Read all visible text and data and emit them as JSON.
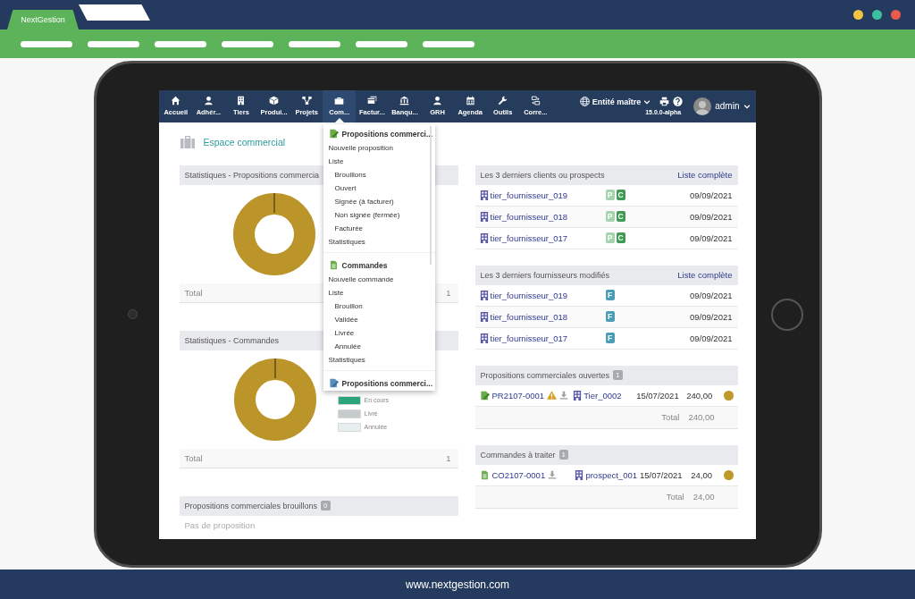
{
  "browser": {
    "tabs": [
      {
        "label": "NextGestion",
        "selected": true
      }
    ],
    "footer": "www.nextgestion.com"
  },
  "app": {
    "menu": [
      {
        "label": "Accueil",
        "selected": false
      },
      {
        "label": "Adhér...",
        "selected": false
      },
      {
        "label": "Tiers",
        "selected": false
      },
      {
        "label": "Produi...",
        "selected": false
      },
      {
        "label": "Projets",
        "selected": false
      },
      {
        "label": "Com...",
        "selected": true
      },
      {
        "label": "Factur...",
        "selected": false
      },
      {
        "label": "Banqu...",
        "selected": false
      },
      {
        "label": "GRH",
        "selected": false
      },
      {
        "label": "Agenda",
        "selected": false
      },
      {
        "label": "Outils",
        "selected": false
      },
      {
        "label": "Corre...",
        "selected": false
      }
    ],
    "entity": "Entité maître",
    "version": "15.0.0-alpha",
    "user": "admin"
  },
  "dropdown": {
    "sections": [
      {
        "title": "Propositions commerci...",
        "items": [
          {
            "label": "Nouvelle proposition"
          },
          {
            "label": "Liste",
            "children": [
              {
                "label": "Brouillons"
              },
              {
                "label": "Ouvert"
              },
              {
                "label": "Signée (à facturer)"
              },
              {
                "label": "Non signée (fermée)"
              },
              {
                "label": "Facturée"
              }
            ]
          },
          {
            "label": "Statistiques"
          }
        ]
      },
      {
        "title": "Commandes",
        "items": [
          {
            "label": "Nouvelle commande"
          },
          {
            "label": "Liste",
            "children": [
              {
                "label": "Brouillon"
              },
              {
                "label": "Validée"
              },
              {
                "label": "Livrée"
              },
              {
                "label": "Annulée"
              }
            ]
          },
          {
            "label": "Statistiques"
          }
        ]
      },
      {
        "title": "Propositions commerci..."
      }
    ]
  },
  "page_title": "Espace commercial",
  "left_panels": [
    {
      "kind": "chart",
      "title": "Statistiques - Propositions commercia",
      "total_label": "Total",
      "total": "1"
    },
    {
      "kind": "chart",
      "title": "Statistiques - Commandes",
      "legend": [
        {
          "label": "En cours",
          "color": "#2aa57c"
        },
        {
          "label": "Livré",
          "color": "#c6cccb"
        },
        {
          "label": "Annulée",
          "color": "#e6eeee"
        }
      ],
      "total_label": "Total",
      "total": "1"
    },
    {
      "kind": "empty",
      "title": "Propositions commerciales brouillons",
      "badge": "0",
      "message": "Pas de proposition"
    }
  ],
  "right_panels": [
    {
      "kind": "thirdparties",
      "title": "Les 3 derniers clients ou prospects",
      "link": "Liste complète",
      "rows": [
        {
          "name": "tier_fournisseur_019",
          "tags": [
            {
              "text": "P",
              "kind": "prospect"
            },
            {
              "text": "C",
              "kind": "customer"
            }
          ],
          "date": "09/09/2021"
        },
        {
          "name": "tier_fournisseur_018",
          "tags": [
            {
              "text": "P",
              "kind": "prospect"
            },
            {
              "text": "C",
              "kind": "customer"
            }
          ],
          "date": "09/09/2021"
        },
        {
          "name": "tier_fournisseur_017",
          "tags": [
            {
              "text": "P",
              "kind": "prospect"
            },
            {
              "text": "C",
              "kind": "customer"
            }
          ],
          "date": "09/09/2021"
        }
      ]
    },
    {
      "kind": "thirdparties",
      "title": "Les 3 derniers fournisseurs modifiés",
      "link": "Liste complète",
      "rows": [
        {
          "name": "tier_fournisseur_019",
          "tags": [
            {
              "text": "F",
              "kind": "supplier"
            }
          ],
          "date": "09/09/2021"
        },
        {
          "name": "tier_fournisseur_018",
          "tags": [
            {
              "text": "F",
              "kind": "supplier"
            }
          ],
          "date": "09/09/2021"
        },
        {
          "name": "tier_fournisseur_017",
          "tags": [
            {
              "text": "F",
              "kind": "supplier"
            }
          ],
          "date": "09/09/2021"
        }
      ]
    },
    {
      "kind": "proposals",
      "title": "Propositions commerciales ouvertes",
      "badge": "1",
      "rows": [
        {
          "ref": "PR2107-0001",
          "warning": true,
          "company": "Tier_0002",
          "date": "15/07/2021",
          "amount": "240,00",
          "color": "#bf9a2a"
        }
      ],
      "total_label": "Total",
      "total": "240,00"
    },
    {
      "kind": "orders",
      "title": "Commandes à traiter",
      "badge": "1",
      "rows": [
        {
          "ref": "CO2107-0001",
          "warning": false,
          "company": "prospect_001",
          "date": "15/07/2021",
          "amount": "24,00",
          "color": "#bf9a2a"
        }
      ],
      "total_label": "Total",
      "total": "24,00"
    }
  ]
}
